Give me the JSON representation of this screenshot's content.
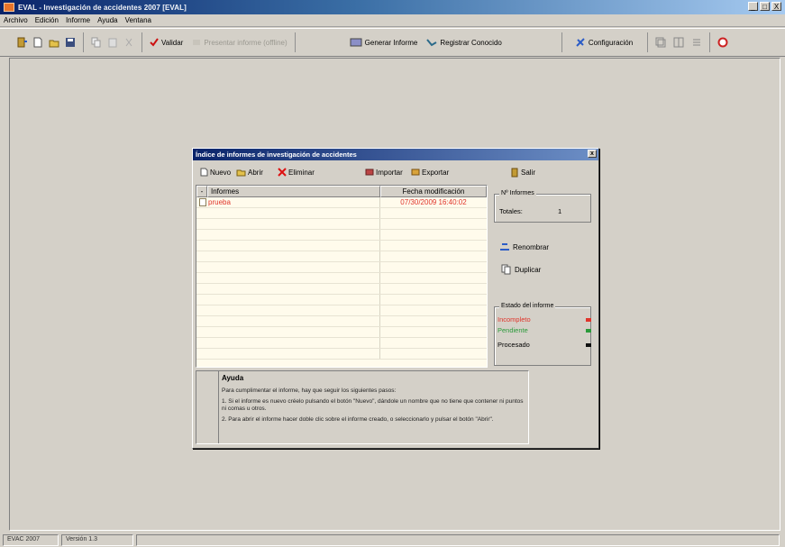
{
  "window": {
    "title": "EVAL - Investigación de accidentes 2007 [EVAL]",
    "controls": [
      "_",
      "□",
      "X"
    ]
  },
  "menu": [
    "Archivo",
    "Edición",
    "Informe",
    "Ayuda",
    "Ventana"
  ],
  "toolbar": {
    "validate_label": "Validar",
    "disabled_label": "Presentar informe (offline)",
    "generate_label": "Generar Informe",
    "register_label": "Registrar Conocido",
    "config_label": "Configuración"
  },
  "dialog": {
    "title": "Índice de informes de investigación de accidentes",
    "toolbar": {
      "new": "Nuevo",
      "open": "Abrir",
      "delete": "Eliminar",
      "import": "Importar",
      "export": "Exportar",
      "exit": "Salir"
    },
    "list": {
      "columns": [
        "Informes",
        "Fecha modificación"
      ],
      "rows": [
        {
          "name": "prueba",
          "date": "07/30/2009 16:40:02"
        }
      ]
    },
    "totals": {
      "title": "Nº Informes",
      "label": "Totales:",
      "value": "1"
    },
    "actions": {
      "rename": "Renombrar",
      "duplicate": "Duplicar"
    },
    "status": {
      "title": "Estado del informe",
      "items": [
        {
          "label": "Incompleto",
          "color": "#e0352b"
        },
        {
          "label": "Pendiente",
          "color": "#2a9a3a"
        },
        {
          "label": "Procesado",
          "color": "#111111"
        }
      ]
    },
    "help": {
      "title": "Ayuda",
      "p1": "Para cumplimentar el informe, hay que seguir los siguientes pasos:",
      "p2": "1. Si el informe es nuevo créelo pulsando el botón \"Nuevo\", dándole un nombre que no tiene que contener ni puntos ni comas u otros.",
      "p3": "2. Para abrir el informe hacer doble clic sobre el informe creado, o seleccionarlo y pulsar el botón \"Abrir\"."
    }
  },
  "statusbar": {
    "left": "EVAC 2007",
    "version": "Versión 1.3"
  },
  "colors": {
    "accent_red": "#e0352b",
    "title_blue": "#0a246a"
  }
}
